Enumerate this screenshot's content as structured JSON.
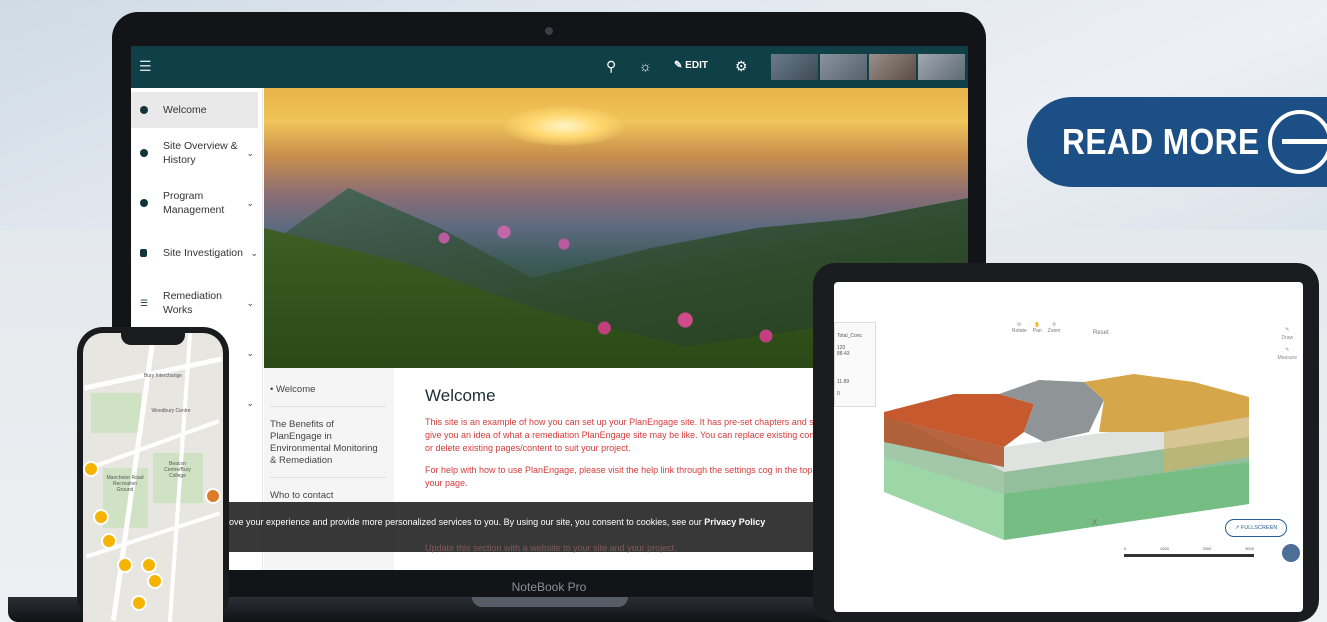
{
  "laptop": {
    "label": "NoteBook Pro",
    "topbar": {
      "menu_icon": "hamburger-icon",
      "search_icon": "search-icon",
      "theme_icon": "brightness-icon",
      "edit_label": "EDIT",
      "settings_icon": "gear-icon"
    },
    "sidebar": {
      "items": [
        {
          "label": "Welcome",
          "active": true
        },
        {
          "label": "Site Overview & History"
        },
        {
          "label": "Program Management"
        },
        {
          "label": "Site Investigation"
        },
        {
          "label": "Remediation Works"
        }
      ]
    },
    "page_nav": {
      "items": [
        "• Welcome",
        "The Benefits of PlanEngage in Environmental Monitoring & Remediation",
        "Who to contact"
      ]
    },
    "content": {
      "title": "Welcome",
      "paragraphs": [
        "This site is an example of how you can set up your PlanEngage site. It has pre-set chapters and st",
        "give you an idea of what a remediation PlanEngage site may be like. You can replace existing cont",
        "or delete existing pages/content to suit your project.",
        "For help with how to use PlanEngage, please visit the help link through the settings cog in the top",
        "your page."
      ],
      "faded_line": "Update this section with a website to your site and your project."
    },
    "cookie_banner": {
      "text": "ove your experience and provide more personalized services to you. By using our site, you consent to cookies, see our ",
      "link": "Privacy Policy"
    },
    "colors": {
      "topbar": "#0f3f47",
      "content_text": "#d43b3b"
    }
  },
  "read_more": {
    "label": "READ MORE",
    "icon": "minus-circle-icon",
    "color": "#1d4f87"
  },
  "tablet": {
    "legend_title": "Total_Conc",
    "legend_values": [
      "120",
      "88.43",
      "11.89",
      "0"
    ],
    "tools": [
      "Rotate",
      "Pan",
      "Zoom"
    ],
    "reset_label": "Reset",
    "side_tools": [
      "Draw",
      "Measure"
    ],
    "fullscreen_label": "FULLSCREEN",
    "scale_labels": [
      "0",
      "1000",
      "2000",
      "3000"
    ],
    "axis_label": "X"
  },
  "phone": {
    "map_labels": [
      "Bury Interchange",
      "Woodbury Centre",
      "Mancheter Road Recreation Ground",
      "Beacon Centre/Bury College"
    ]
  }
}
